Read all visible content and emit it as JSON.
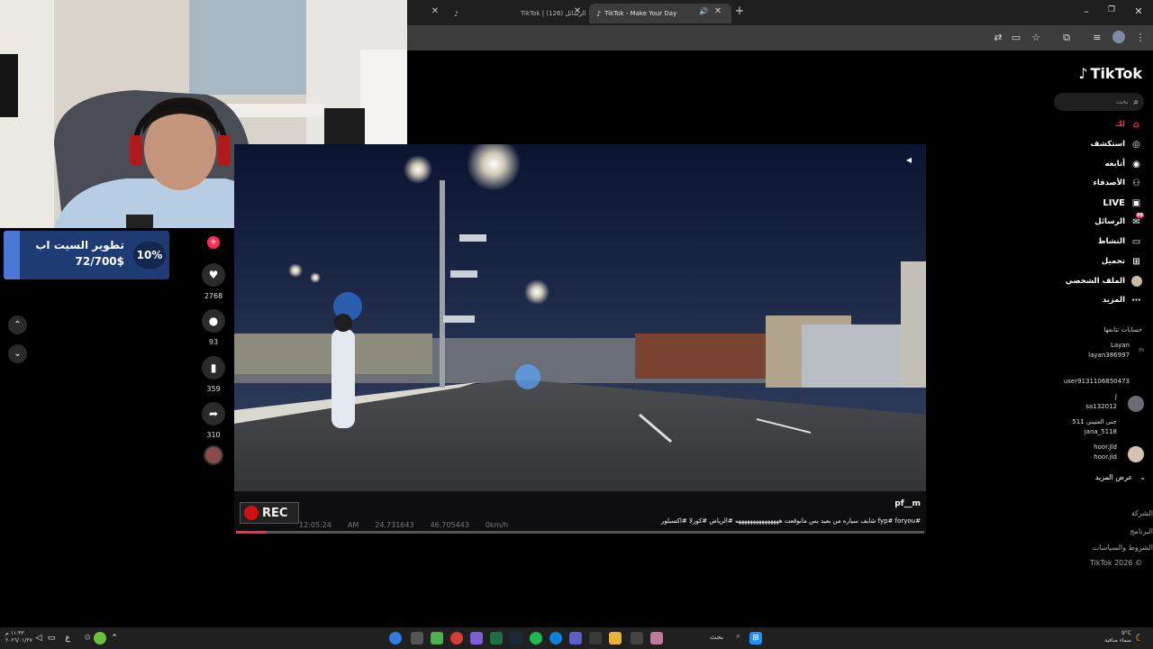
{
  "browser": {
    "tabs": [
      {
        "label": ""
      },
      {
        "label": "TikTok | الرسائل (126)"
      },
      {
        "label": "TikTok - Make Your Day"
      }
    ]
  },
  "sidebar": {
    "brand": "TikTok",
    "search_placeholder": "بحث",
    "nav": [
      {
        "label": "لك",
        "icon": "home-icon"
      },
      {
        "label": "استكشف",
        "icon": "compass-icon"
      },
      {
        "label": "أتابعه",
        "icon": "following-icon"
      },
      {
        "label": "الأصدقاء",
        "icon": "friends-icon"
      },
      {
        "label": "LIVE",
        "icon": "live-icon"
      },
      {
        "label": "الرسائل",
        "icon": "messages-icon",
        "badge": "99"
      },
      {
        "label": "النشاط",
        "icon": "activity-icon"
      },
      {
        "label": "تحميل",
        "icon": "upload-icon"
      },
      {
        "label": "الملف الشخصي",
        "icon": "profile-icon"
      },
      {
        "label": "المزيد",
        "icon": "more-icon"
      }
    ],
    "following_title": "حسابات تتابعها",
    "accounts": [
      {
        "name": "Layan",
        "handle": "layan386997"
      },
      {
        "name": "",
        "handle": "user9131106850473"
      },
      {
        "name": "J",
        "handle": "sa132012"
      },
      {
        "name": "جنى العتيبي 511",
        "handle": "jana_5118"
      },
      {
        "name": "hoor.Jld",
        "handle": "hoor.jld"
      }
    ],
    "see_more": "عرض المزيد",
    "footer": [
      "الشركة",
      "البرنامج",
      "الشروط والسياسات",
      "TikTok 2026 ©"
    ]
  },
  "overlay": {
    "goal_percent": "10%",
    "goal_fraction": 0.1,
    "goal_title": "تطوير السيت اب",
    "goal_amount": "72/700$"
  },
  "actions": {
    "likes": "2768",
    "comments": "93",
    "saves": "359",
    "shares": "310"
  },
  "video": {
    "rec": "REC",
    "time": "12:05:24",
    "ampm": "AM",
    "lat": "24.731643",
    "lon": "46.705443",
    "speed": "0km/h",
    "author": "pf__m",
    "caption": "شايف سياره من بعيد بس مانوقعت هههههههههههههههه  #الرياض #كورلا #اكسبلور fyp# foryou#"
  },
  "taskbar": {
    "search": "بحث",
    "weather_temp": "9°C",
    "weather_desc": "سماء صافية",
    "clock_time": "١١:٣٣ م",
    "clock_date": "٢٠٢٦/٠١/٢٧",
    "lang": "ع"
  },
  "colors": {
    "tiktok_pink": "#fe2c55",
    "goal_bg": "#1f3b73",
    "goal_fill": "#4a78d4"
  }
}
